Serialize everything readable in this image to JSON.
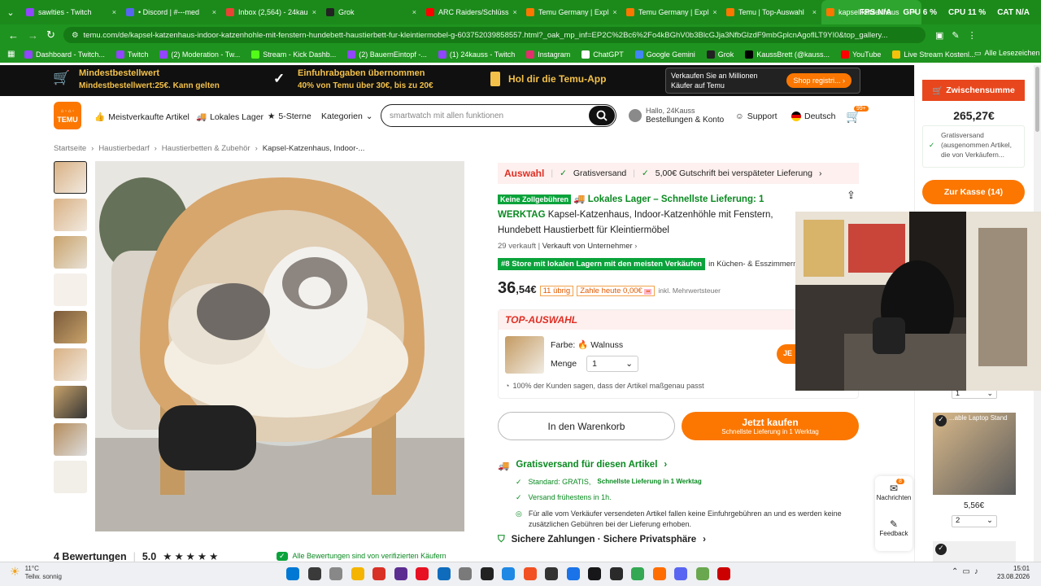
{
  "browser": {
    "tabs": [
      {
        "label": "sawlties - Twitch",
        "color": "#9146ff"
      },
      {
        "label": "• Discord | #---med",
        "color": "#5865f2"
      },
      {
        "label": "Inbox (2,564) - 24kau",
        "color": "#ea4335"
      },
      {
        "label": "Grok",
        "color": "#222222"
      },
      {
        "label": "ARC Raiders/Schlüss",
        "color": "#ff0000"
      },
      {
        "label": "Temu Germany | Expl",
        "color": "#fb7701"
      },
      {
        "label": "Temu Germany | Expl",
        "color": "#fb7701"
      },
      {
        "label": "Temu | Top-Auswahl",
        "color": "#fb7701"
      },
      {
        "label": "kapsel katzenhaus",
        "color": "#fb7701"
      }
    ],
    "overlay_stats": [
      "FPS N/A",
      "GPU 6 %",
      "CPU 11 %",
      "CAT N/A"
    ],
    "url": "temu.com/de/kapsel-katzenhaus-indoor-katzenhohle-mit-fenstern-hundebett-haustierbett-fur-kleintiermobel-g-603752039858557.html?_oak_mp_inf=EP2C%2Bc6%2Fo4kBGhV0b3BlcGJja3NfbGlzdF9mbGplcnAgoflLT9YI0&top_gallery...",
    "bookmarks": [
      {
        "label": "Dashboard - Twitch...",
        "color": "#9146ff"
      },
      {
        "label": "Twitch",
        "color": "#9146ff"
      },
      {
        "label": "(2) Moderation - Tw...",
        "color": "#9146ff"
      },
      {
        "label": "Stream - Kick Dashb...",
        "color": "#53fc18"
      },
      {
        "label": "(2) BauernEintopf -...",
        "color": "#9146ff"
      },
      {
        "label": "(1) 24kauss - Twitch",
        "color": "#9146ff"
      },
      {
        "label": "Instagram",
        "color": "#e1306c"
      },
      {
        "label": "ChatGPT",
        "color": "#ffffff"
      },
      {
        "label": "Google Gemini",
        "color": "#4285f4"
      },
      {
        "label": "Grok",
        "color": "#222222"
      },
      {
        "label": "KaussBrett (@kauss...",
        "color": "#000000"
      },
      {
        "label": "YouTube",
        "color": "#ff0000"
      },
      {
        "label": "Live Stream Kostenl...",
        "color": "#f4c20d"
      }
    ],
    "all_bookmarks": "Alle Lesezeichen"
  },
  "promo": {
    "min_title": "Mindestbestellwert",
    "min_sub": "Mindestbestellwert:25€. Kann gelten",
    "import_title": "Einfuhrabgaben übernommen",
    "import_sub": "40% von Temu über 30€, bis zu 20€",
    "app": "Hol dir die Temu-App",
    "sell_title": "Verkaufen Sie an Millionen",
    "sell_sub": "Käufer auf Temu",
    "sell_btn": "Shop registri..."
  },
  "header": {
    "logo_top": "Ⓡ ✿ TEMU",
    "logo_bottom": "TEMU",
    "nav": [
      "Meistverkaufte Artikel",
      "Lokales Lager",
      "5-Sterne",
      "Kategorien"
    ],
    "search_placeholder": "smartwatch mit allen funktionen",
    "account_greeting": "Hallo, 24Kauss",
    "account_label": "Bestellungen & Konto",
    "support": "Support",
    "language": "Deutsch",
    "cart_badge": "99+"
  },
  "breadcrumbs": [
    "Startseite",
    "Haustierbedarf",
    "Haustierbetten & Zubehör",
    "Kapsel-Katzenhaus, Indoor-..."
  ],
  "product": {
    "auswahl": "Auswahl",
    "gratisversand": "Gratisversand",
    "gutschrift": "5,00€ Gutschrift bei verspäteter Lieferung",
    "keine_zoll": "Keine Zollgebühren",
    "lokales_lager": "Lokales Lager – Schnellste Lieferung: 1",
    "werktag": "WERKTAG",
    "title": "Kapsel-Katzenhaus, Indoor-Katzenhöhle mit Fenstern, Hundebett Haustierbett für Kleintiermöbel",
    "sold": "29 verkauft",
    "seller": "Verkauft von Unternehmer",
    "rank_badge": "#8 Store mit lokalen Lagern mit den meisten Verkäufen",
    "rank_category": "in Küchen- & Esszimmermöbel",
    "price_main": "36",
    "price_cents": ",54€",
    "stock": "11 übrig",
    "pay_today": "Zahle heute 0,00€",
    "tax_note": "inkl. Mehrwertsteuer",
    "top_label": "TOP-AUSWAHL",
    "color_label": "Farbe:",
    "color_value": "Walnuss",
    "qty_label": "Menge",
    "qty_value": "1",
    "buy_side_btn": "JE",
    "fit_note": "100% der Kunden sagen, dass der Artikel maßgenau passt",
    "add_to_cart": "In den Warenkorb",
    "buy_now": "Jetzt kaufen",
    "buy_now_sub": "Schnellste Lieferung in 1 Werktag",
    "shipping_title": "Gratisversand für diesen Artikel",
    "ship_standard": "Standard: GRATIS,",
    "ship_standard_sub": "Schnellste Lieferung in 1 Werktag",
    "ship_earliest": "Versand frühestens in 1h.",
    "ship_note": "Für alle vom Verkäufer versendeten Artikel fallen keine Einfuhrgebühren an und es werden keine zusätzlichen Gebühren bei der Lieferung erhoben.",
    "secure": "Sichere Zahlungen · Sichere Privatsphäre",
    "reviews": "4 Bewertungen",
    "rating": "5.0",
    "verified": "Alle Bewertungen sind von verifizierten Käufern"
  },
  "sidebar": {
    "subtotal_label": "Zwischensumme",
    "subtotal": "265,27€",
    "free_ship": "Gratisversand (ausgenommen Artikel, die von Verkäufern...",
    "checkout": "Zur Kasse (14)",
    "qty1": "1",
    "item_title": "...able Laptop Stand",
    "item_price": "5,56€",
    "qty2": "2"
  },
  "float": {
    "badge": "8",
    "news": "Nachrichten",
    "feedback": "Feedback"
  },
  "taskbar": {
    "temp": "11°C",
    "weather": "Teilw. sonnig",
    "time": "15:01",
    "date": "23.08.2026"
  }
}
